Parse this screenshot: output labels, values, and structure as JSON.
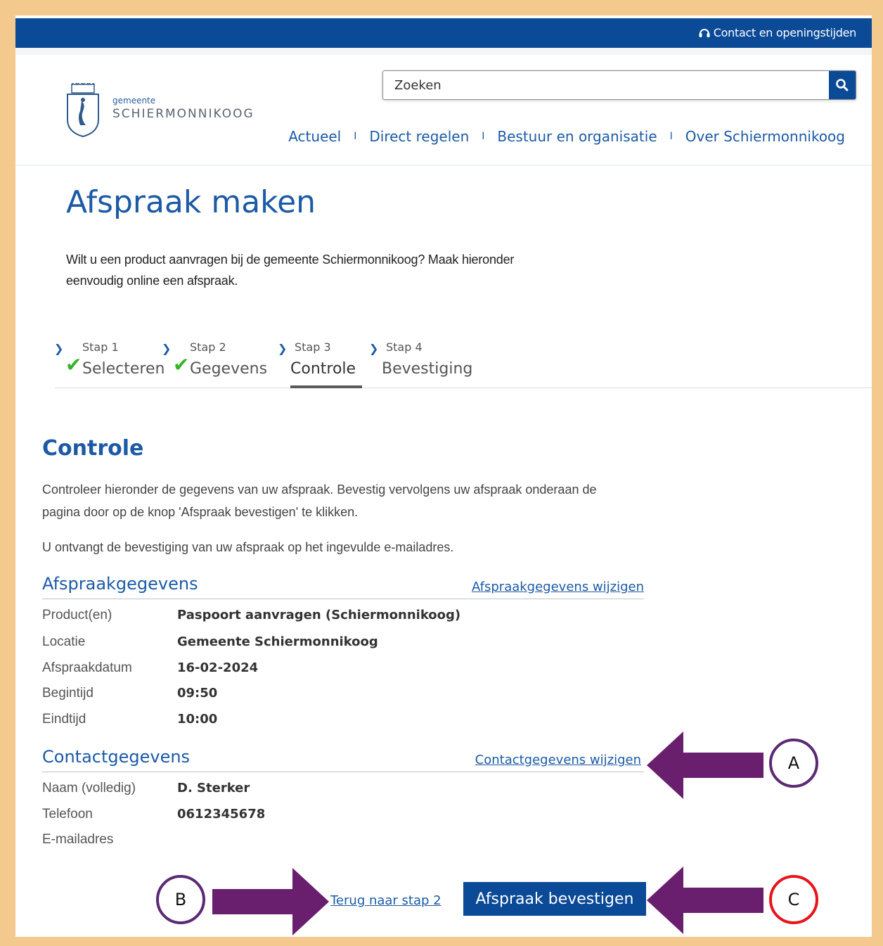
{
  "topbar": {
    "contact_label": "Contact en openingstijden"
  },
  "header": {
    "logo_small": "gemeente",
    "logo_big": "SCHIERMONNIKOOG",
    "search_placeholder": "Zoeken",
    "nav": [
      "Actueel",
      "Direct regelen",
      "Bestuur en organisatie",
      "Over Schiermonnikoog"
    ],
    "nav_separator": "I"
  },
  "page": {
    "title": "Afspraak maken",
    "intro": "Wilt u een product aanvragen bij de gemeente Schiermonnikoog? Maak hieronder eenvoudig online een afspraak."
  },
  "steps": [
    {
      "num": "Stap 1",
      "name": "Selecteren",
      "done": true
    },
    {
      "num": "Stap 2",
      "name": "Gegevens",
      "done": true
    },
    {
      "num": "Stap 3",
      "name": "Controle",
      "active": true
    },
    {
      "num": "Stap 4",
      "name": "Bevestiging"
    }
  ],
  "controle": {
    "title": "Controle",
    "para1": "Controleer hieronder de gegevens van uw afspraak. Bevestig vervolgens uw afspraak onderaan de pagina door op de knop 'Afspraak bevestigen' te klikken.",
    "para2": "U ontvangt de bevestiging van uw afspraak op het ingevulde e-mailadres."
  },
  "afspraak": {
    "title": "Afspraakgegevens",
    "edit_link": "Afspraakgegevens wijzigen",
    "rows": [
      {
        "label": "Product(en)",
        "value": "Paspoort aanvragen (Schiermonnikoog)"
      },
      {
        "label": "Locatie",
        "value": "Gemeente Schiermonnikoog"
      },
      {
        "label": "Afspraakdatum",
        "value": "16-02-2024"
      },
      {
        "label": "Begintijd",
        "value": "09:50"
      },
      {
        "label": "Eindtijd",
        "value": "10:00"
      }
    ]
  },
  "contact": {
    "title": "Contactgegevens",
    "edit_link": "Contactgegevens wijzigen",
    "rows": [
      {
        "label": "Naam (volledig)",
        "value": "D. Sterker"
      },
      {
        "label": "Telefoon",
        "value": "0612345678"
      },
      {
        "label": "E-mailadres",
        "value": ""
      }
    ]
  },
  "actions": {
    "back_link": "Terug naar stap 2",
    "confirm_button": "Afspraak bevestigen"
  },
  "annotations": {
    "a_label": "A",
    "b_label": "B",
    "c_label": "C",
    "arrow_color": "#6a1f6e",
    "badge_border_purple": "#5b2a73",
    "badge_border_red": "#e8141b"
  },
  "colors": {
    "brand_blue": "#0b4a97",
    "link_blue": "#1c5aa5",
    "check_green": "#35b427",
    "frame": "#f3c98e"
  }
}
